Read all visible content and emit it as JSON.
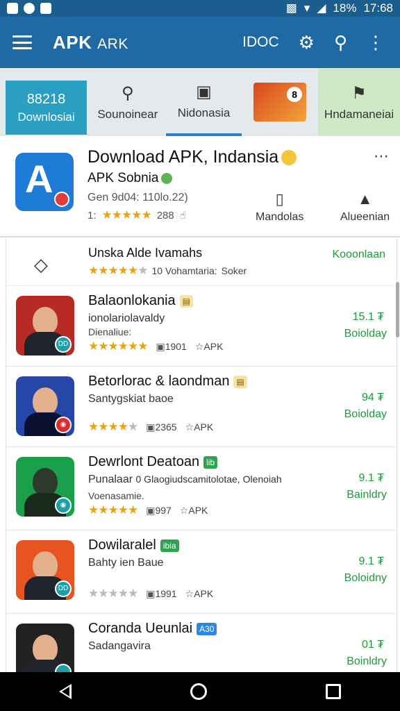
{
  "status_bar": {
    "time": "17:68",
    "battery": "18%"
  },
  "app_bar": {
    "title": "APK",
    "title_secondary": "ARK",
    "right_text": "IDOC",
    "icons": [
      "menu-icon",
      "settings-icon",
      "search-icon",
      "more-vert-icon"
    ]
  },
  "tabs": [
    {
      "top": "88218",
      "label": "Downlosiai"
    },
    {
      "icon": "search-icon",
      "label": "Sounoinear"
    },
    {
      "icon": "chat-icon",
      "label": "Nidonasia"
    },
    {
      "icon": "thumbnail",
      "badge": "8"
    },
    {
      "icon": "share-icon",
      "label": "Hndamaneiai"
    }
  ],
  "hero": {
    "title": "Download APK, Indansia",
    "subtitle": "APK Sobnia",
    "meta": "Gen 9d04: 110lo.22)",
    "rating_prefix": "1:",
    "rating_count": "288",
    "actions": [
      {
        "icon": "book-icon",
        "label": "Mandolas"
      },
      {
        "icon": "lock-icon",
        "label": "Alueenian"
      }
    ]
  },
  "list": {
    "first": {
      "name": "Unska Alde Ivamahs",
      "meta": "10 Vohamtaria:",
      "meta2": "Soker",
      "link": "Kooonlaan"
    },
    "apps": [
      {
        "title": "Balaonlokania",
        "sub": "ionolariolavaldy",
        "sub2": "Dienaliue:",
        "count": "1901",
        "apk": "APK",
        "size": "15.1 ₮",
        "btn": "Boiolday",
        "accent": "#c43b2b"
      },
      {
        "title": "Betorlorac & laondman",
        "sub": "Santygskiat baoe",
        "sub2": "",
        "count": "2365",
        "apk": "APK",
        "size": "94 ₮",
        "btn": "Boiolday",
        "accent": "#2747a8"
      },
      {
        "title": "Dewrlont Deatoan",
        "tag": "lib",
        "sub": "Punalaar",
        "sub_extra": "0 Glaogiudscamitolotae, Olenoiah",
        "sub2": "Voenasamie.",
        "count": "997",
        "apk": "APK",
        "size": "9.1 ₮",
        "btn": "Bainldry",
        "accent": "#1aa04a"
      },
      {
        "title": "Dowilaralel",
        "tag": "ibia",
        "sub": "Bahty ien Baue",
        "sub2": "",
        "count": "1991",
        "apk": "APK",
        "size": "9.1 ₮",
        "btn": "Boloidny",
        "accent": "#e8541f"
      },
      {
        "title": "Coranda Ueunlai",
        "tag": "A30",
        "sub": "Sadangavira",
        "sub2": "",
        "count": "",
        "apk": "",
        "size": "01 ₮",
        "btn": "Boinldry",
        "accent": "#222"
      }
    ]
  },
  "colors": {
    "app_bar": "#1f6aa5",
    "status_bar": "#1a5d8f",
    "accent_green": "#1c9a3a",
    "star": "#e6a417"
  }
}
